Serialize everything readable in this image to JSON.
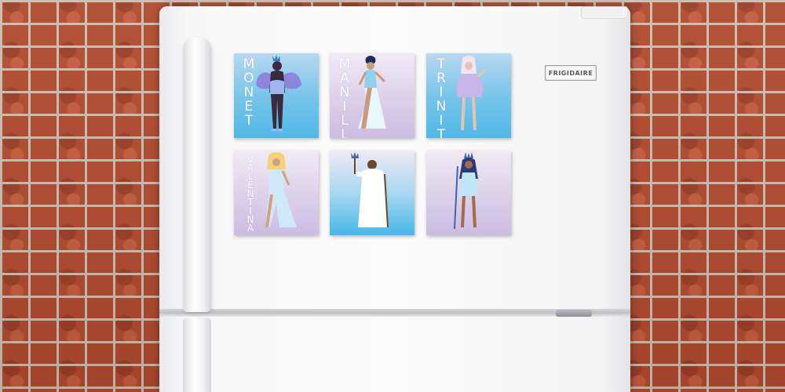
{
  "brand": {
    "label": "FRIGIDAIRE"
  },
  "magnets": [
    {
      "name": "MONET",
      "background": "blue",
      "skin": "#3a2a3d",
      "outfit": "#9fb6f0",
      "accent": "#8b74d8"
    },
    {
      "name": "MANILLA",
      "background": "lilac",
      "skin": "#c89a7e",
      "outfit": "#8fd2f0",
      "accent": "#1c2b5a"
    },
    {
      "name": "TRINITY",
      "background": "blue",
      "skin": "#e9c3b0",
      "outfit": "#c9b6e8",
      "accent": "#f3e6f4"
    },
    {
      "name": "VALENTINA",
      "background": "lilac",
      "skin": "#d6a07f",
      "outfit": "#cfe9f8",
      "accent": "#f4d27a"
    },
    {
      "name": "",
      "background": "mixblue",
      "skin": "#6e4630",
      "outfit": "#ffffff",
      "accent": "#d7c0ea"
    },
    {
      "name": "",
      "background": "lilac",
      "skin": "#a56a4a",
      "outfit": "#bfe6f7",
      "accent": "#2a3b7a"
    }
  ],
  "colors": {
    "brick": "#b14a2e",
    "mortar": "#c9beb0",
    "fridge": "#f7f7f8"
  }
}
